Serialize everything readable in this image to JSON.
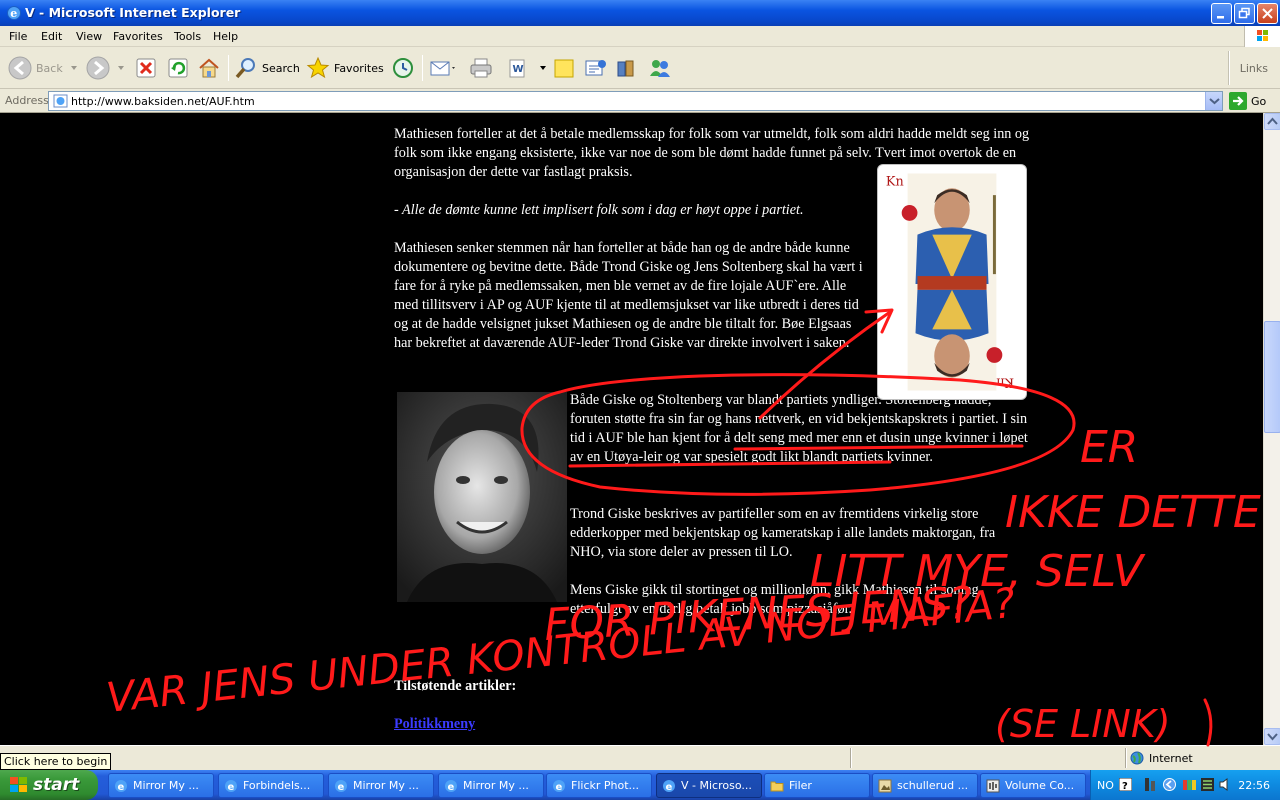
{
  "window": {
    "title": "V - Microsoft Internet Explorer"
  },
  "menu": [
    "File",
    "Edit",
    "View",
    "Favorites",
    "Tools",
    "Help"
  ],
  "toolbar": {
    "back_label": "Back",
    "search_label": "Search",
    "favorites_label": "Favorites",
    "links_label": "Links"
  },
  "address": {
    "label": "Address",
    "url": "http://www.baksiden.net/AUF.htm",
    "go_label": "Go"
  },
  "article": {
    "p1": "Mathiesen forteller at det å betale medlemsskap for folk som var utmeldt, folk som aldri hadde meldt seg inn og folk som ikke engang eksisterte, ikke var noe de som ble dømt hadde funnet på selv. Tvert imot overtok de en organisasjon der dette var fastlagt praksis.",
    "p2": "- Alle de dømte kunne lett implisert folk som i dag er høyt oppe i partiet.",
    "p3": "Mathiesen senker stemmen når han forteller at både han og de andre både kunne dokumentere og bevitne dette. Både Trond Giske og Jens Soltenberg skal ha vært i fare for å ryke på medlemssaken, men ble vernet av de fire lojale AUF`ere. Alle med tillitsverv i AP og AUF kjente til at medlemsjukset var like utbredt i deres tid og at de hadde velsignet jukset Mathiesen og de andre ble tiltalt for. Bøe Elgsaas har bekreftet at daværende AUF-leder Trond Giske var direkte involvert i saken.",
    "p4a": "Både Giske og Stoltenberg var blandt partiets yndliger. Stoltenberg hadde, foruten støtte fra sin far og hans nettverk, en vid bekjentskapskrets i partiet.",
    "p4b": " I sin tid i AUF ble han kjent for å delt seng med mer enn et dusin unge kvinner i løpet av en Utøya-leir",
    "p4c": " og var spesielt godt likt blandt partiets kvinner.",
    "p5": "Trond Giske beskrives av partifeller som en av fremtidens virkelig store edderkopper med bekjentskap og kameratskap i alle landets maktorgan, fra NHO, via store deler av pressen til LO.",
    "p6": "Mens Giske gikk til stortinget og millionlønn, gikk Mathiesen til soning etterfulgt av en dårlig betalt jobb som pizzasjåfør.",
    "related_heading": "Tilstøtende artikler:",
    "menu_link": "Politikkmeny"
  },
  "annotations": {
    "color": "#ff1a1a",
    "lines": [
      "ER",
      "IKKE DETTE",
      "LITT MYE, SELV",
      "FOR PIKENES JENS?",
      "VAR JENS UNDER KONTROLL AV NOE MAFIA?",
      "(SE LINK)"
    ]
  },
  "status": {
    "tooltip": "Click here to begin",
    "zone": "Internet"
  },
  "taskbar": {
    "start_label": "start",
    "tasks": [
      "Mirror My ...",
      "Forbindels...",
      "Mirror My ...",
      "Mirror My ...",
      "Flickr Phot...",
      "V - Microso...",
      "Filer",
      "schullerud ...",
      "Volume Co..."
    ],
    "language": "NO",
    "clock": "22:56"
  },
  "colors": {
    "titlebar": "#0a54e0",
    "chrome": "#ece9d8",
    "taskbar": "#245edb",
    "start_button": "#3a9a3a",
    "link": "#3b3bff"
  }
}
